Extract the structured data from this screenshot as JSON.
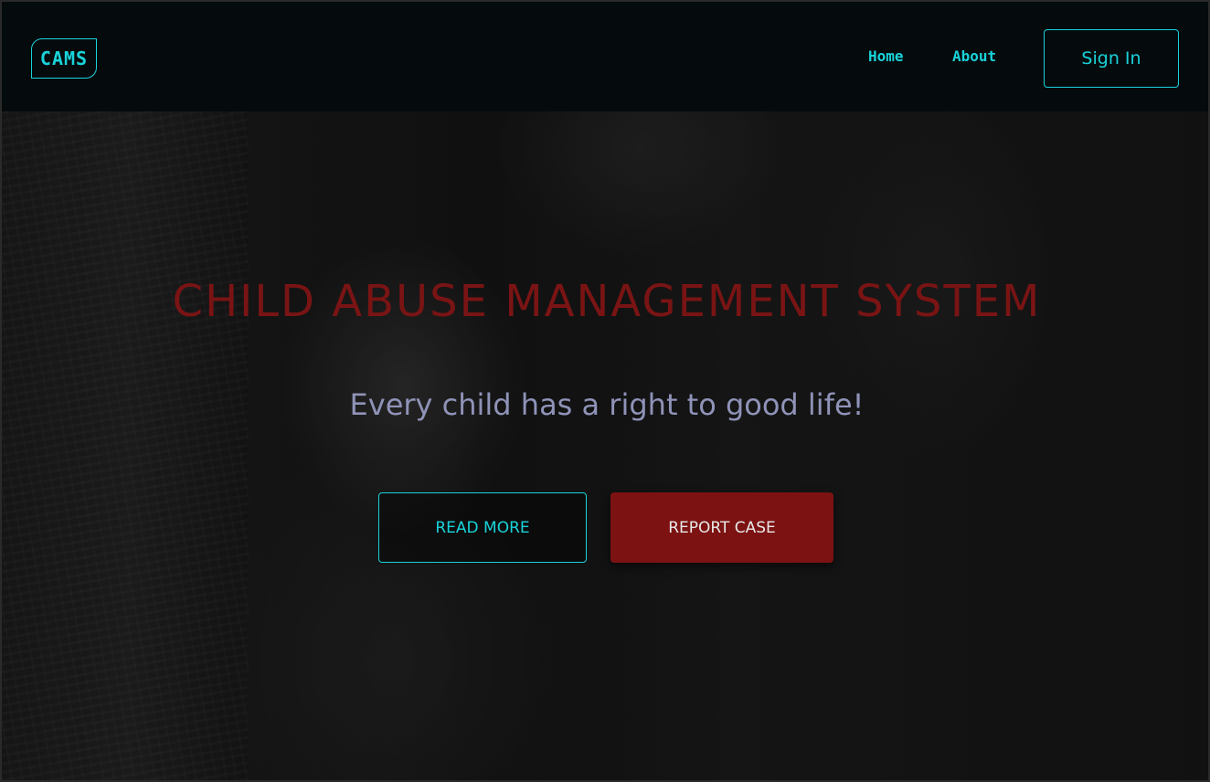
{
  "navbar": {
    "logo": "CAMS",
    "links": [
      {
        "label": "Home"
      },
      {
        "label": "About"
      }
    ],
    "signin_label": "Sign In"
  },
  "hero": {
    "title": "CHILD ABUSE MANAGEMENT SYSTEM",
    "subtitle": "Every child has a right to good life!",
    "read_more_label": "READ MORE",
    "report_label": "REPORT CASE"
  },
  "colors": {
    "accent": "#19d3da",
    "title_red": "#7a1414",
    "report_button": "#7c1212",
    "navbar_bg": "#050b0d",
    "subtitle": "#8f93b8"
  }
}
